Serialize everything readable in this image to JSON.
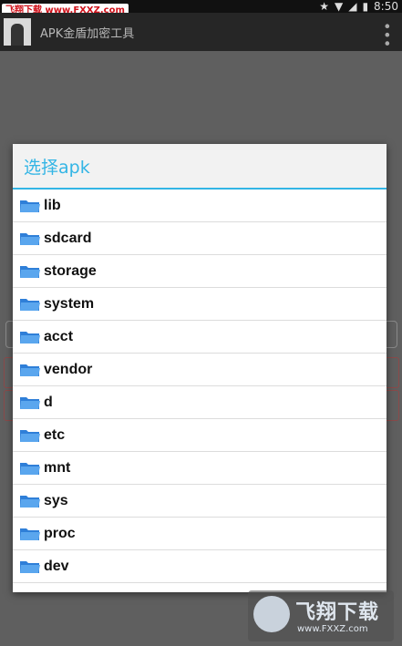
{
  "statusbar": {
    "time": "8:50"
  },
  "watermark_top": "飞翔下载 www.FXXZ.com",
  "appbar": {
    "title": "APK金盾加密工具"
  },
  "dialog": {
    "title": "选择apk",
    "items": [
      {
        "label": "lib"
      },
      {
        "label": "sdcard"
      },
      {
        "label": "storage"
      },
      {
        "label": "system"
      },
      {
        "label": "acct"
      },
      {
        "label": "vendor"
      },
      {
        "label": "d"
      },
      {
        "label": "etc"
      },
      {
        "label": "mnt"
      },
      {
        "label": "sys"
      },
      {
        "label": "proc"
      },
      {
        "label": "dev"
      }
    ]
  },
  "watermark_logo": {
    "text": "飞翔下载",
    "url": "www.FXXZ.com"
  },
  "colors": {
    "accent": "#33b5e5",
    "folder": "#3d8ee0"
  }
}
